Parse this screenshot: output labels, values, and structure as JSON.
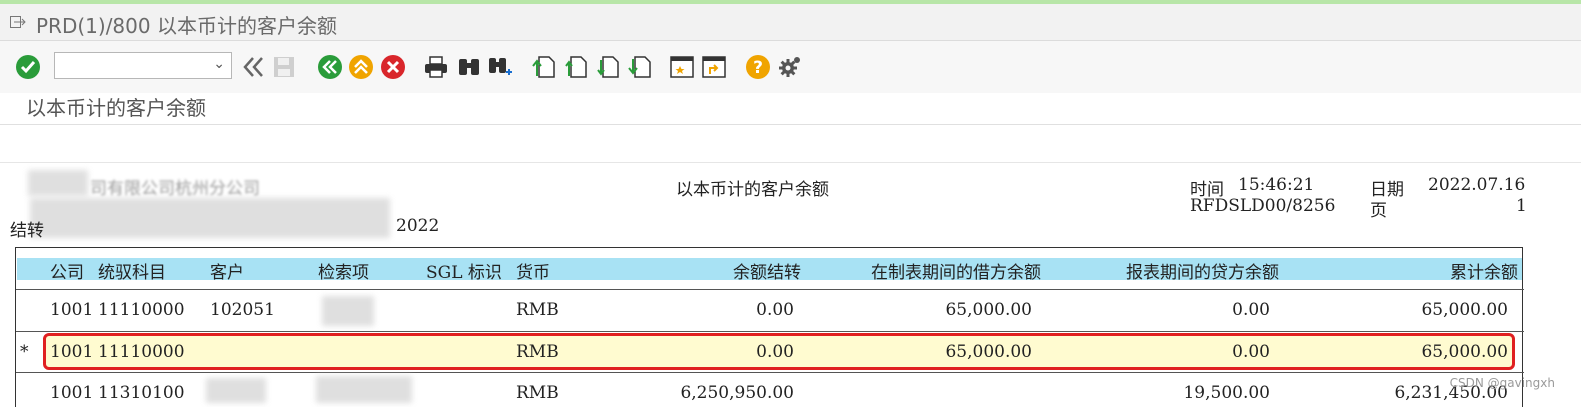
{
  "window": {
    "title": "PRD(1)/800 以本币计的客户余额"
  },
  "toolbar": {
    "command_field": {
      "value": "",
      "placeholder": ""
    },
    "icons": [
      "enter-icon",
      "back-icon",
      "save-icon",
      "back-green-icon",
      "exit-icon",
      "cancel-icon",
      "print-icon",
      "find-icon",
      "find-next-icon",
      "first-page-icon",
      "previous-page-icon",
      "next-page-icon",
      "last-page-icon",
      "create-session-icon",
      "shortcut-icon",
      "help-icon",
      "settings-icon"
    ]
  },
  "page": {
    "title": "以本币计的客户余额"
  },
  "report": {
    "center_title": "以本币计的客户余额",
    "company_visible": "司有限公司杭州分公司",
    "line3_prefix": "结转",
    "year": "2022",
    "time_label": "时间",
    "time_value": "15:46:21",
    "date_label": "日期",
    "date_value": "2022.07.16",
    "program": "RFDSLD00/8256",
    "page_label": "页",
    "page_value": "1"
  },
  "table": {
    "headers": {
      "company": "公司",
      "account": "统驭科目",
      "customer": "客户",
      "search": "检索项",
      "sgl": "SGL 标识",
      "currency": "货币",
      "carry": "余额结转",
      "debit": "在制表期间的借方余额",
      "credit": "报表期间的贷方余额",
      "total": "累计余额"
    },
    "rows": [
      {
        "marker": "",
        "company": "1001",
        "account": "11110000",
        "customer": "102051",
        "search": "",
        "sgl": "",
        "currency": "RMB",
        "carry": "0.00",
        "debit": "65,000.00",
        "credit": "0.00",
        "total": "65,000.00"
      },
      {
        "marker": "*",
        "company": "1001",
        "account": "11110000",
        "customer": "",
        "search": "",
        "sgl": "",
        "currency": "RMB",
        "carry": "0.00",
        "debit": "65,000.00",
        "credit": "0.00",
        "total": "65,000.00"
      },
      {
        "marker": "",
        "company": "1001",
        "account": "11310100",
        "customer": "",
        "search": "",
        "sgl": "",
        "currency": "RMB",
        "carry": "6,250,950.00",
        "debit": "19,500.00",
        "credit": "",
        "total": "6,231,450.00"
      }
    ]
  },
  "watermark": "CSDN @gavingxh",
  "colors": {
    "header_bg": "#a8e2f4",
    "highlight_row": "#fffbd0",
    "highlight_border": "#e02020",
    "enter_green": "#2a9c3a",
    "orange": "#f0a400",
    "red": "#d9262b"
  }
}
